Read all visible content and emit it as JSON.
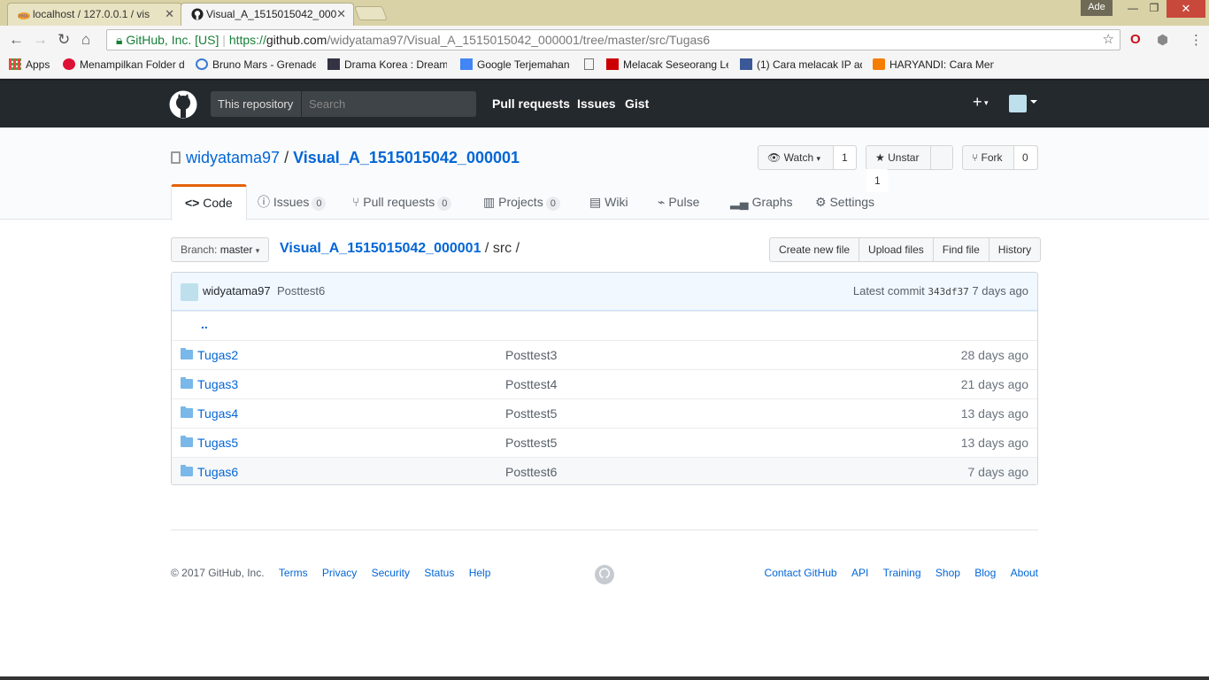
{
  "browser": {
    "tabs": [
      {
        "title": "localhost / 127.0.0.1 / vis",
        "active": false
      },
      {
        "title": "Visual_A_1515015042_000",
        "active": true
      }
    ],
    "user_label": "Ade",
    "url": {
      "site": "GitHub, Inc. [US]",
      "scheme": "https://",
      "host": "github.com",
      "path": "/widyatama97/Visual_A_1515015042_000001/tree/master/src/Tugas6"
    },
    "bookmarks": [
      {
        "label": "Apps",
        "icon": "apps-grid-icon"
      },
      {
        "label": "Menampilkan Folder d",
        "icon": "ri-icon"
      },
      {
        "label": "Bruno Mars - Grenade",
        "icon": "magnifier-icon"
      },
      {
        "label": "Drama Korea : Dream",
        "icon": "thumbnail-icon"
      },
      {
        "label": "Google Terjemahan",
        "icon": "translate-icon"
      },
      {
        "label": "",
        "icon": "page-icon"
      },
      {
        "label": "Melacak Seseorang Le",
        "icon": "h-icon"
      },
      {
        "label": "(1) Cara melacak IP ad",
        "icon": "facebook-icon"
      },
      {
        "label": "HARYANDI: Cara Men",
        "icon": "blogger-icon"
      }
    ]
  },
  "header": {
    "scope_label": "This repository",
    "search_placeholder": "Search",
    "nav": [
      "Pull requests",
      "Issues",
      "Gist"
    ],
    "plus": "+"
  },
  "repo": {
    "owner": "widyatama97",
    "separator": "/",
    "name": "Visual_A_1515015042_000001",
    "watch": {
      "label": "Watch",
      "count": "1"
    },
    "star": {
      "label": "Unstar",
      "count": "1"
    },
    "fork": {
      "label": "Fork",
      "count": "0"
    },
    "tabs": [
      {
        "label": "Code"
      },
      {
        "label": "Issues",
        "count": "0"
      },
      {
        "label": "Pull requests",
        "count": "0"
      },
      {
        "label": "Projects",
        "count": "0"
      },
      {
        "label": "Wiki"
      },
      {
        "label": "Pulse"
      },
      {
        "label": "Graphs"
      },
      {
        "label": "Settings"
      }
    ]
  },
  "filenav": {
    "branch_prefix": "Branch:",
    "branch": "master",
    "crumb_repo": "Visual_A_1515015042_000001",
    "crumb_sep": "/",
    "crumb_dir": "src",
    "crumb_end": "/",
    "buttons": [
      "Create new file",
      "Upload files",
      "Find file",
      "History"
    ]
  },
  "commit": {
    "author": "widyatama97",
    "message": "Posttest6",
    "latest_label": "Latest commit",
    "sha": "343df37",
    "age": "7 days ago"
  },
  "files": {
    "up": "..",
    "rows": [
      {
        "name": "Tugas2",
        "message": "Posttest3",
        "age": "28 days ago"
      },
      {
        "name": "Tugas3",
        "message": "Posttest4",
        "age": "21 days ago"
      },
      {
        "name": "Tugas4",
        "message": "Posttest5",
        "age": "13 days ago"
      },
      {
        "name": "Tugas5",
        "message": "Posttest5",
        "age": "13 days ago"
      },
      {
        "name": "Tugas6",
        "message": "Posttest6",
        "age": "7 days ago"
      }
    ]
  },
  "footer": {
    "copyright": "© 2017 GitHub, Inc.",
    "left_links": [
      "Terms",
      "Privacy",
      "Security",
      "Status",
      "Help"
    ],
    "right_links": [
      "Contact GitHub",
      "API",
      "Training",
      "Shop",
      "Blog",
      "About"
    ]
  }
}
